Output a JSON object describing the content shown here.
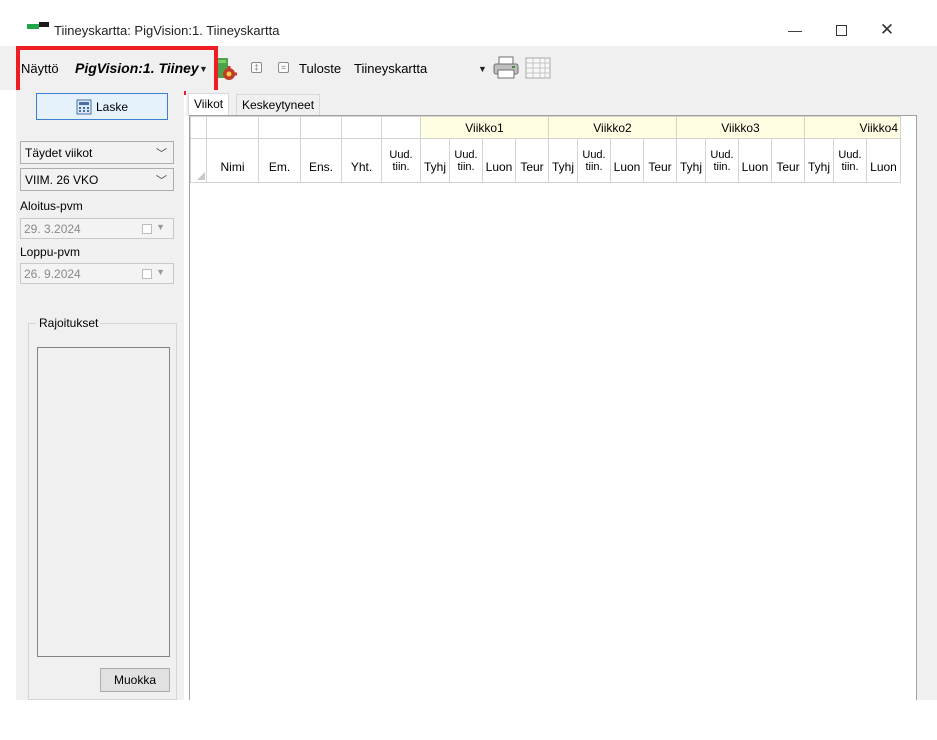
{
  "window": {
    "title": "Tiineyskartta: PigVision:1. Tiineyskartta",
    "minimize": "—",
    "close": "✕"
  },
  "toolbar": {
    "view_label": "Näyttö",
    "view_value": "PigVision:1. Tiiney",
    "print_label": "Tuloste",
    "print_value": "Tiineyskartta"
  },
  "left": {
    "calc_button": "Laske",
    "period_select": "Täydet viikot",
    "range_select": "VIIM. 26 VKO",
    "start_label": "Aloitus-pvm",
    "start_value": "29. 3.2024",
    "end_label": "Loppu-pvm",
    "end_value": "26. 9.2024",
    "restrictions_title": "Rajoitukset",
    "edit_button": "Muokka"
  },
  "tabs": [
    {
      "label": "Viikot",
      "active": true
    },
    {
      "label": "Keskeytyneet",
      "active": false
    }
  ],
  "grid": {
    "fixed_columns": [
      "Nimi",
      "Em.",
      "Ens.",
      "Yht."
    ],
    "new_pregnant": [
      "Uud.",
      "tiin."
    ],
    "weeks": [
      {
        "label": "Viikko1",
        "columns": [
          "Tyhj",
          "Uud. tiin.",
          "Luon",
          "Teur"
        ]
      },
      {
        "label": "Viikko2",
        "columns": [
          "Tyhj",
          "Uud. tiin.",
          "Luon",
          "Teur"
        ]
      },
      {
        "label": "Viikko3",
        "columns": [
          "Tyhj",
          "Uud. tiin.",
          "Luon",
          "Teur"
        ]
      },
      {
        "label": "Viikko4",
        "columns": [
          "Tyhj",
          "Uud. tiin.",
          "Luon"
        ]
      }
    ]
  },
  "colors": {
    "highlight": "#ee1c24",
    "week_header_bg": "#fffde2",
    "accent_button_border": "#3c7fd0"
  }
}
